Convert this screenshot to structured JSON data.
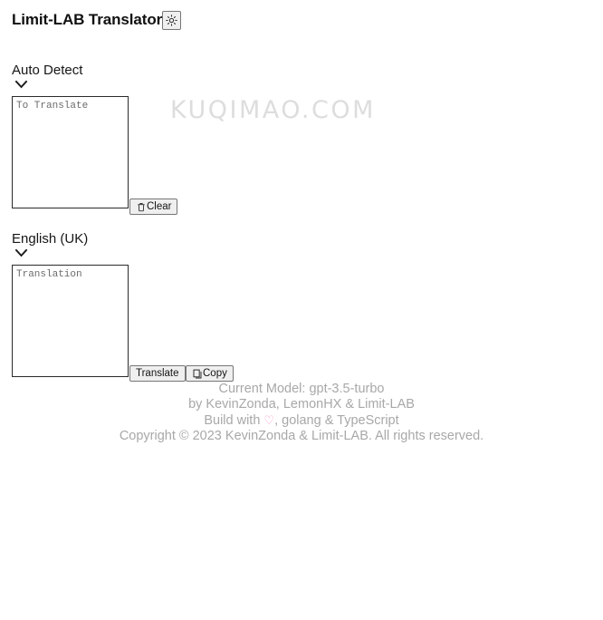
{
  "header": {
    "title": "Limit-LAB Translator",
    "theme_toggle_icon": "brightness-sun-icon"
  },
  "source": {
    "language_label": "Auto Detect",
    "chevron_icon": "chevron-down-icon",
    "textarea_value": "",
    "textarea_placeholder": "To Translate",
    "clear_button": {
      "label": "Clear",
      "icon": "trash-icon"
    }
  },
  "target": {
    "language_label": "English (UK)",
    "chevron_icon": "chevron-down-icon",
    "textarea_value": "",
    "textarea_placeholder": "Translation",
    "translate_button": {
      "label": "Translate"
    },
    "copy_button": {
      "label": "Copy",
      "icon": "copy-icon"
    }
  },
  "watermark": {
    "text": "KUQIMAO.COM"
  },
  "footer": {
    "current_model": "Current Model: gpt-3.5-turbo",
    "authors": "by KevinZonda, LemonHX & Limit-LAB",
    "build_with_prefix": "Build with ",
    "build_with_heart": "♡",
    "build_with_suffix": ", golang & TypeScript",
    "copyright": "Copyright © 2023 KevinZonda & Limit-LAB. All rights reserved.",
    "text_color": "#a8a8a8",
    "heart_color": "#f49ac1"
  }
}
